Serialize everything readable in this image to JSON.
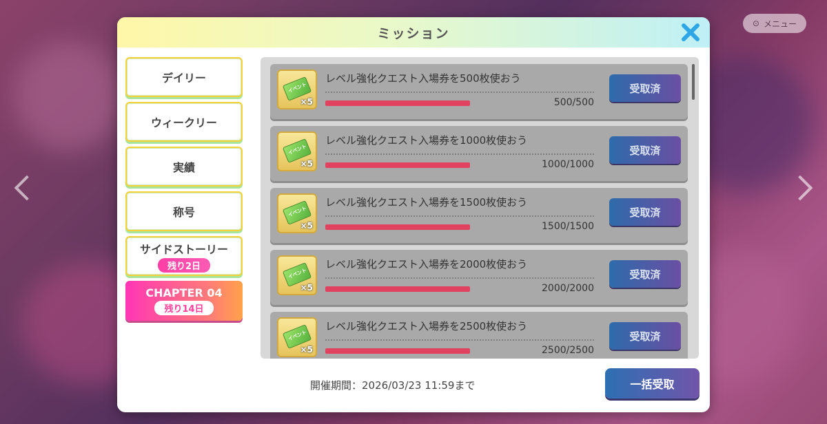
{
  "background": {
    "top_right_buttons": [
      "",
      "メニュー"
    ]
  },
  "modal": {
    "title": "ミッション",
    "close_icon": "close-icon"
  },
  "tabs": [
    {
      "label": "デイリー",
      "badge": null,
      "active": false
    },
    {
      "label": "ウィークリー",
      "badge": null,
      "active": false
    },
    {
      "label": "実績",
      "badge": null,
      "active": false
    },
    {
      "label": "称号",
      "badge": null,
      "active": false
    },
    {
      "label": "サイドストーリー",
      "badge": "残り2日",
      "active": false
    },
    {
      "label": "CHAPTER 04",
      "badge": "残り14日",
      "active": true
    }
  ],
  "missions": [
    {
      "title": "レベル強化クエスト入場券を500枚使おう",
      "reward_icon": "event-ticket-icon",
      "reward_label": "イベント",
      "reward_qty": "×5",
      "progress_text": "500/500",
      "progress": 1.0,
      "button": "受取済"
    },
    {
      "title": "レベル強化クエスト入場券を1000枚使おう",
      "reward_icon": "event-ticket-icon",
      "reward_label": "イベント",
      "reward_qty": "×5",
      "progress_text": "1000/1000",
      "progress": 1.0,
      "button": "受取済"
    },
    {
      "title": "レベル強化クエスト入場券を1500枚使おう",
      "reward_icon": "event-ticket-icon",
      "reward_label": "イベント",
      "reward_qty": "×5",
      "progress_text": "1500/1500",
      "progress": 1.0,
      "button": "受取済"
    },
    {
      "title": "レベル強化クエスト入場券を2000枚使おう",
      "reward_icon": "event-ticket-icon",
      "reward_label": "イベント",
      "reward_qty": "×5",
      "progress_text": "2000/2000",
      "progress": 1.0,
      "button": "受取済"
    },
    {
      "title": "レベル強化クエスト入場券を2500枚使おう",
      "reward_icon": "event-ticket-icon",
      "reward_label": "イベント",
      "reward_qty": "×5",
      "progress_text": "2500/2500",
      "progress": 1.0,
      "button": "受取済"
    }
  ],
  "footer": {
    "period": "開催期間：2026/03/23 11:59まで",
    "bulk_button": "一括受取"
  },
  "colors": {
    "header_gradient": [
      "#fff7a8",
      "#bff0f6"
    ],
    "active_tab_gradient": [
      "#ff36b5",
      "#ffa24a"
    ],
    "progress_fill": "#e0425f",
    "button_gradient": [
      "#2e6baa",
      "#6a4fa3"
    ]
  }
}
